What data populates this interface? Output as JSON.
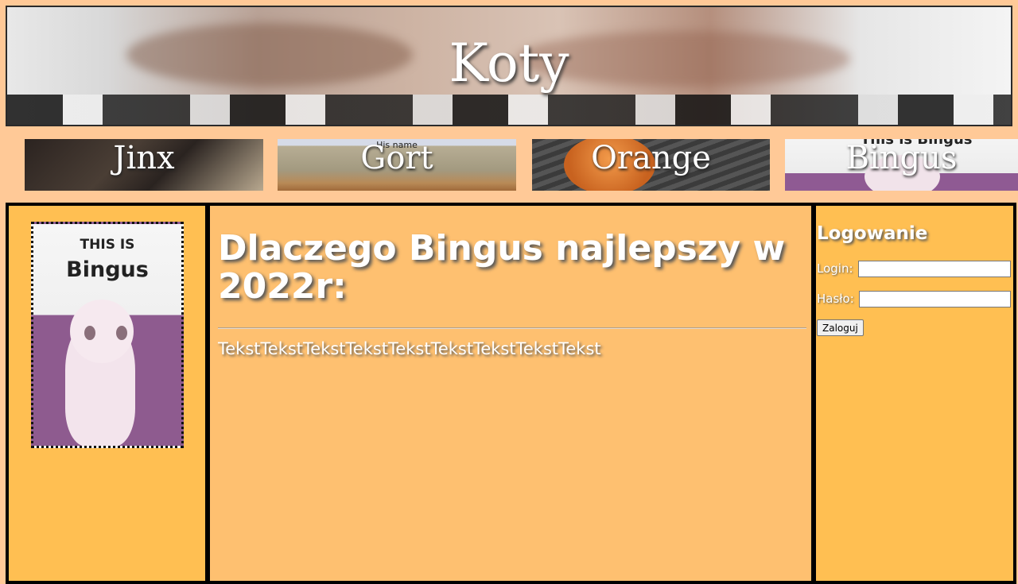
{
  "header": {
    "title": "Koty"
  },
  "nav": {
    "items": [
      {
        "label": "Jinx"
      },
      {
        "label": "Gort"
      },
      {
        "label": "Orange"
      },
      {
        "label": "Bingus"
      }
    ]
  },
  "sidebar": {
    "image": {
      "caption_top": "THIS IS",
      "caption_name": "Bingus"
    }
  },
  "main": {
    "heading": "Dlaczego Bingus najlepszy w 2022r:",
    "text": "TekstTekstTekstTekstTekstTekstTekstTekstTekst"
  },
  "login": {
    "title": "Logowanie",
    "login_label": "Login:",
    "password_label": "Hasło:",
    "login_value": "",
    "password_value": "",
    "submit_label": "Zaloguj"
  },
  "nav_tile_texts": {
    "gort_caption": "His name",
    "bingus_caption": "This is Bingus"
  },
  "colors": {
    "background": "#ffc997",
    "sidebar": "#ffbf52",
    "main": "#fec070"
  }
}
